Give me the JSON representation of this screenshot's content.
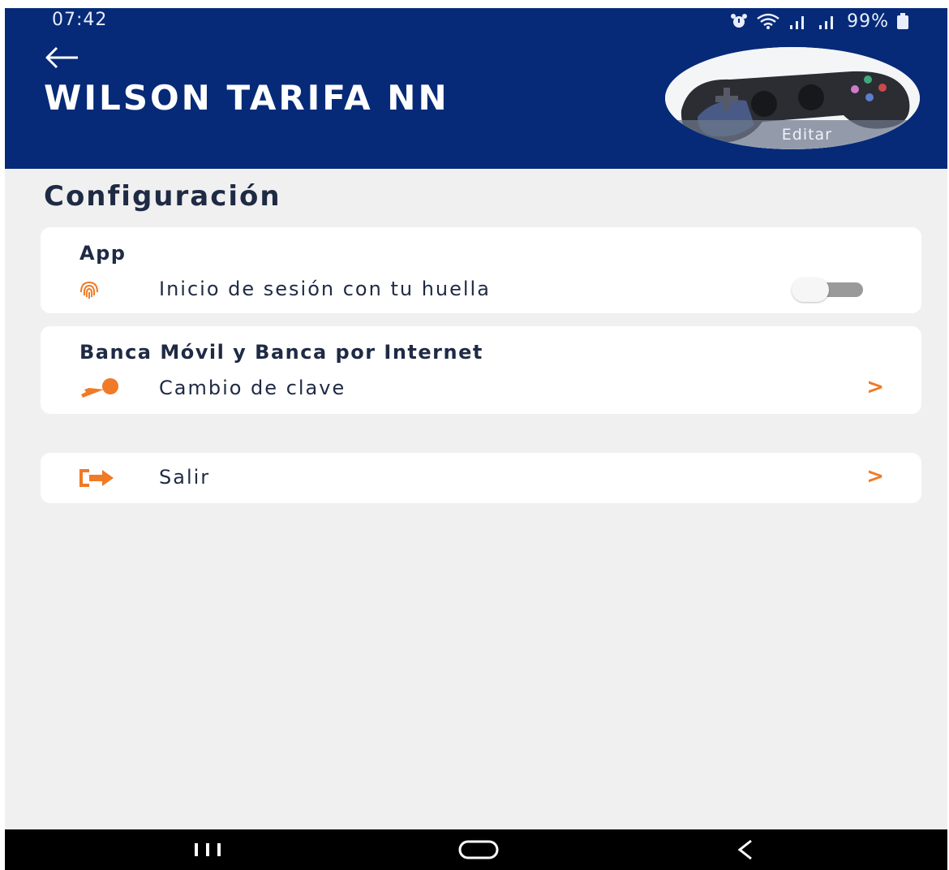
{
  "status_bar": {
    "time": "07:42",
    "battery": "99%",
    "icons": [
      "alarm-icon",
      "wifi-icon",
      "signal-icon",
      "signal-icon",
      "battery-icon"
    ]
  },
  "header": {
    "back_icon": "back-arrow-icon",
    "user_name": "WILSON TARIFA NN",
    "avatar_edit_label": "Editar"
  },
  "page": {
    "title": "Configuración"
  },
  "sections": {
    "app": {
      "heading": "App",
      "fingerprint_label": "Inicio de sesión con tu huella",
      "fingerprint_enabled": false
    },
    "banca": {
      "heading": "Banca Móvil y Banca por Internet",
      "change_password_label": "Cambio de clave"
    },
    "logout": {
      "label": "Salir"
    }
  },
  "chevron": ">",
  "colors": {
    "header_bg": "#062a78",
    "accent": "#f07a25",
    "background": "#f0f0f0"
  }
}
